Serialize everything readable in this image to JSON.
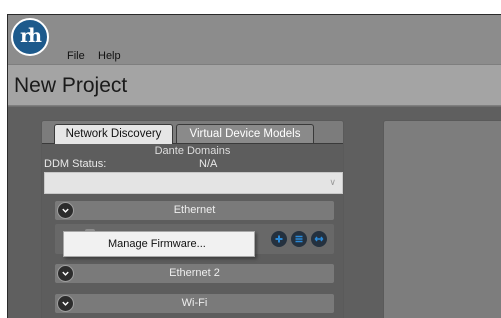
{
  "app": {
    "logo_text": "rh",
    "menu": [
      "File",
      "Help"
    ],
    "project_title": "New Project"
  },
  "tabs": [
    {
      "label": "Network Discovery",
      "active": true
    },
    {
      "label": "Virtual Device Models",
      "active": false
    }
  ],
  "discovery": {
    "dante_domains_label": "Dante Domains",
    "ddm_status_label": "DDM Status:",
    "ddm_status_value": "N/A",
    "ddm_select_value": ""
  },
  "sections": [
    {
      "label": "Ethernet",
      "expanded": true
    },
    {
      "label": "Ethernet 2",
      "expanded": true
    },
    {
      "label": "Wi-Fi",
      "expanded": true
    }
  ],
  "context_menu": {
    "items": [
      "Manage Firmware..."
    ]
  },
  "icons": {
    "toggle": "chevron-down-icon",
    "device": "device-icon",
    "actions": [
      "add-icon",
      "list-icon",
      "link-icon"
    ]
  },
  "colors": {
    "logo": "#1d5a8c",
    "action_icon": "#2a8ad8",
    "action_bg": "#24313f",
    "panel_bg": "#5d5d5d"
  }
}
